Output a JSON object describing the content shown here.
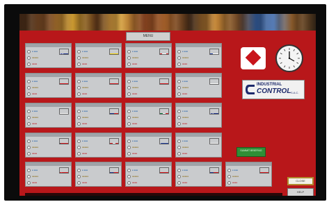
{
  "header": {
    "center_button_label": "MENU"
  },
  "panels": [
    {
      "title": "",
      "flag": "australia",
      "status": [
        "● ●●●",
        "●●●●●",
        "●●●●"
      ]
    },
    {
      "title": "",
      "flag": "brunei",
      "status": [
        "● ●●●",
        "●●●●●",
        "●●●●"
      ]
    },
    {
      "title": "",
      "flag": "canada",
      "status": [
        "● ●●●",
        "●●●●●",
        "●●●●"
      ]
    },
    {
      "title": "",
      "flag": "chile",
      "status": [
        "● ●●●",
        "●●●●●",
        "●●●●"
      ]
    },
    {
      "title": "",
      "flag": "china",
      "status": [
        "● ●●●",
        "●●●●●",
        "●●●●"
      ]
    },
    {
      "title": "",
      "flag": "hong-kong",
      "status": [
        "● ●●●",
        "●●●●●",
        "●●●●"
      ]
    },
    {
      "title": "",
      "flag": "indonesia",
      "status": [
        "● ●●●",
        "●●●●●",
        "●●●●"
      ]
    },
    {
      "title": "",
      "flag": "japan",
      "status": [
        "● ●●●",
        "●●●●●",
        "●●●●"
      ]
    },
    {
      "title": "",
      "flag": "korea",
      "status": [
        "● ●●●",
        "●●●●●",
        "●●●●"
      ]
    },
    {
      "title": "",
      "flag": "malaysia",
      "status": [
        "● ●●●",
        "●●●●●",
        "●●●●"
      ]
    },
    {
      "title": "",
      "flag": "mexico",
      "status": [
        "● ●●●",
        "●●●●●",
        "●●●●"
      ]
    },
    {
      "title": "",
      "flag": "new-zealand",
      "status": [
        "● ●●●",
        "●●●●●",
        "●●●●"
      ]
    },
    {
      "title": "",
      "flag": "papua-new-guinea",
      "status": [
        "● ●●●",
        "●●●●●",
        "●●●●"
      ]
    },
    {
      "title": "",
      "flag": "peru",
      "status": [
        "● ●●●",
        "●●●●●",
        "●●●●"
      ]
    },
    {
      "title": "",
      "flag": "philippines",
      "status": [
        "● ●●●",
        "●●●●●",
        "●●●●"
      ]
    },
    {
      "title": "",
      "flag": "russia",
      "status": [
        "● ●●●",
        "●●●●●",
        "●●●●"
      ]
    },
    {
      "title": "",
      "flag": "singapore",
      "status": [
        "● ●●●",
        "●●●●●",
        "●●●●"
      ]
    },
    {
      "title": "",
      "flag": "chinese-taipei",
      "status": [
        "● ●●●",
        "●●●●●",
        "●●●●"
      ]
    },
    {
      "title": "",
      "flag": "thailand",
      "status": [
        "● ●●●",
        "●●●●●",
        "●●●●"
      ]
    },
    {
      "title": "",
      "flag": "usa",
      "status": [
        "● ●●●",
        "●●●●●",
        "●●●●"
      ]
    },
    {
      "title": "",
      "flag": "vietnam",
      "status": [
        "● ●●●",
        "●●●●●",
        "●●●●"
      ]
    }
  ],
  "logo": {
    "line1": "INDUSTRIAL",
    "line2": "CONTROL",
    "line3": "S.A.C."
  },
  "right": {
    "green_button_label": "SUMMIT\nBRIEFING",
    "button_a": "CLOSE",
    "button_b": "HELP"
  },
  "colors": {
    "screen_bg": "#b8171a",
    "panel_bg": "#c9cbcd",
    "green": "#2f8f36"
  }
}
